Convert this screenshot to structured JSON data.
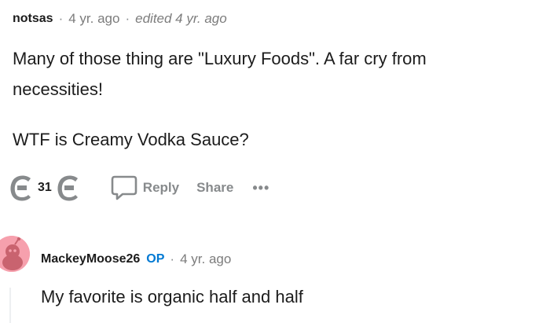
{
  "comment": {
    "author": "notsas",
    "separator": "·",
    "time": "4 yr. ago",
    "edited": "edited 4 yr. ago",
    "body_lines": [
      "Many of those thing are \"Luxury Foods\". A far cry from",
      "necessities!",
      "WTF is Creamy Vodka Sauce?"
    ],
    "score": "31",
    "reply_label": "Reply",
    "share_label": "Share",
    "more_label": "•••"
  },
  "reply": {
    "author": "MackeyMoose26",
    "op_label": "OP",
    "separator": "·",
    "time": "4 yr. ago",
    "body": "My favorite is organic half and half",
    "avatar_color": "#f6a0ad"
  },
  "colors": {
    "text": "#1c1c1c",
    "meta": "#7c7c7c",
    "op": "#0079d3",
    "action": "#878a8c"
  },
  "icons": {
    "upvote": "upvote-icon",
    "downvote": "downvote-icon",
    "reply": "reply-bubble-icon",
    "more": "more-dots-icon"
  }
}
